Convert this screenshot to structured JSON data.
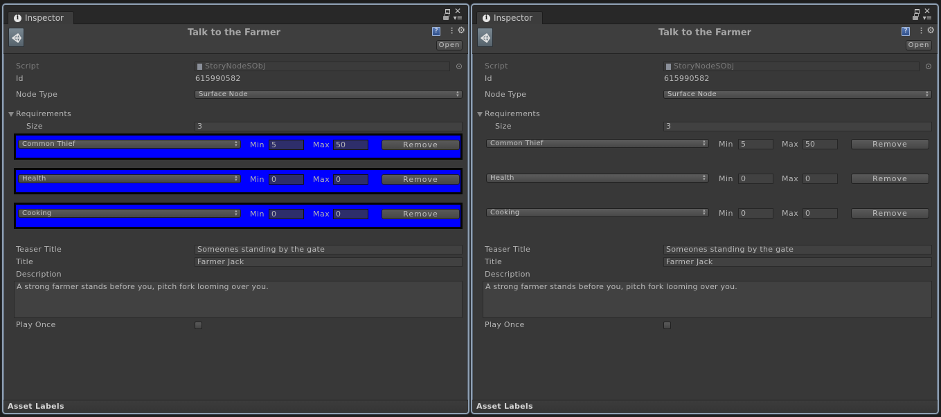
{
  "panels": [
    {
      "id": "left",
      "tab_label": "Inspector",
      "header_title": "Talk to the Farmer",
      "open_label": "Open",
      "script": {
        "label": "Script",
        "value": "StoryNodeSObj"
      },
      "id_field": {
        "label": "Id",
        "value": "615990582"
      },
      "node_type": {
        "label": "Node Type",
        "value": "Surface Node"
      },
      "requirements": {
        "label": "Requirements",
        "expanded": true,
        "size_label": "Size",
        "size_value": "3",
        "highlighted": true,
        "items": [
          {
            "type": "Common Thief",
            "min_label": "Min",
            "min": "5",
            "max_label": "Max",
            "max": "50",
            "remove_label": "Remove"
          },
          {
            "type": "Health",
            "min_label": "Min",
            "min": "0",
            "max_label": "Max",
            "max": "0",
            "remove_label": "Remove"
          },
          {
            "type": "Cooking",
            "min_label": "Min",
            "min": "0",
            "max_label": "Max",
            "max": "0",
            "remove_label": "Remove"
          }
        ]
      },
      "teaser_title": {
        "label": "Teaser Title",
        "value": "Someones standing by the gate"
      },
      "title": {
        "label": "Title",
        "value": "Farmer Jack"
      },
      "description": {
        "label": "Description",
        "value": "A strong farmer stands before you, pitch fork looming over you."
      },
      "play_once": {
        "label": "Play Once",
        "checked": false
      },
      "footer_label": "Asset Labels"
    },
    {
      "id": "right",
      "tab_label": "Inspector",
      "header_title": "Talk to the Farmer",
      "open_label": "Open",
      "script": {
        "label": "Script",
        "value": "StoryNodeSObj"
      },
      "id_field": {
        "label": "Id",
        "value": "615990582"
      },
      "node_type": {
        "label": "Node Type",
        "value": "Surface Node"
      },
      "requirements": {
        "label": "Requirements",
        "expanded": true,
        "size_label": "Size",
        "size_value": "3",
        "highlighted": false,
        "items": [
          {
            "type": "Common Thief",
            "min_label": "Min",
            "min": "5",
            "max_label": "Max",
            "max": "50",
            "remove_label": "Remove"
          },
          {
            "type": "Health",
            "min_label": "Min",
            "min": "0",
            "max_label": "Max",
            "max": "0",
            "remove_label": "Remove"
          },
          {
            "type": "Cooking",
            "min_label": "Min",
            "min": "0",
            "max_label": "Max",
            "max": "0",
            "remove_label": "Remove"
          }
        ]
      },
      "teaser_title": {
        "label": "Teaser Title",
        "value": "Someones standing by the gate"
      },
      "title": {
        "label": "Title",
        "value": "Farmer Jack"
      },
      "description": {
        "label": "Description",
        "value": "A strong farmer stands before you, pitch fork looming over you."
      },
      "play_once": {
        "label": "Play Once",
        "checked": false
      },
      "footer_label": "Asset Labels"
    }
  ],
  "icons": {
    "info": "i",
    "help": "?",
    "preset": "⫶",
    "gear": "⚙",
    "close": "✕",
    "menu": "▾≡",
    "popup_arrows": [
      "▴",
      "▾"
    ]
  },
  "colors": {
    "highlight_background": "#0000ff",
    "panel_background": "#383838",
    "window_border": "#8fa0b3"
  }
}
